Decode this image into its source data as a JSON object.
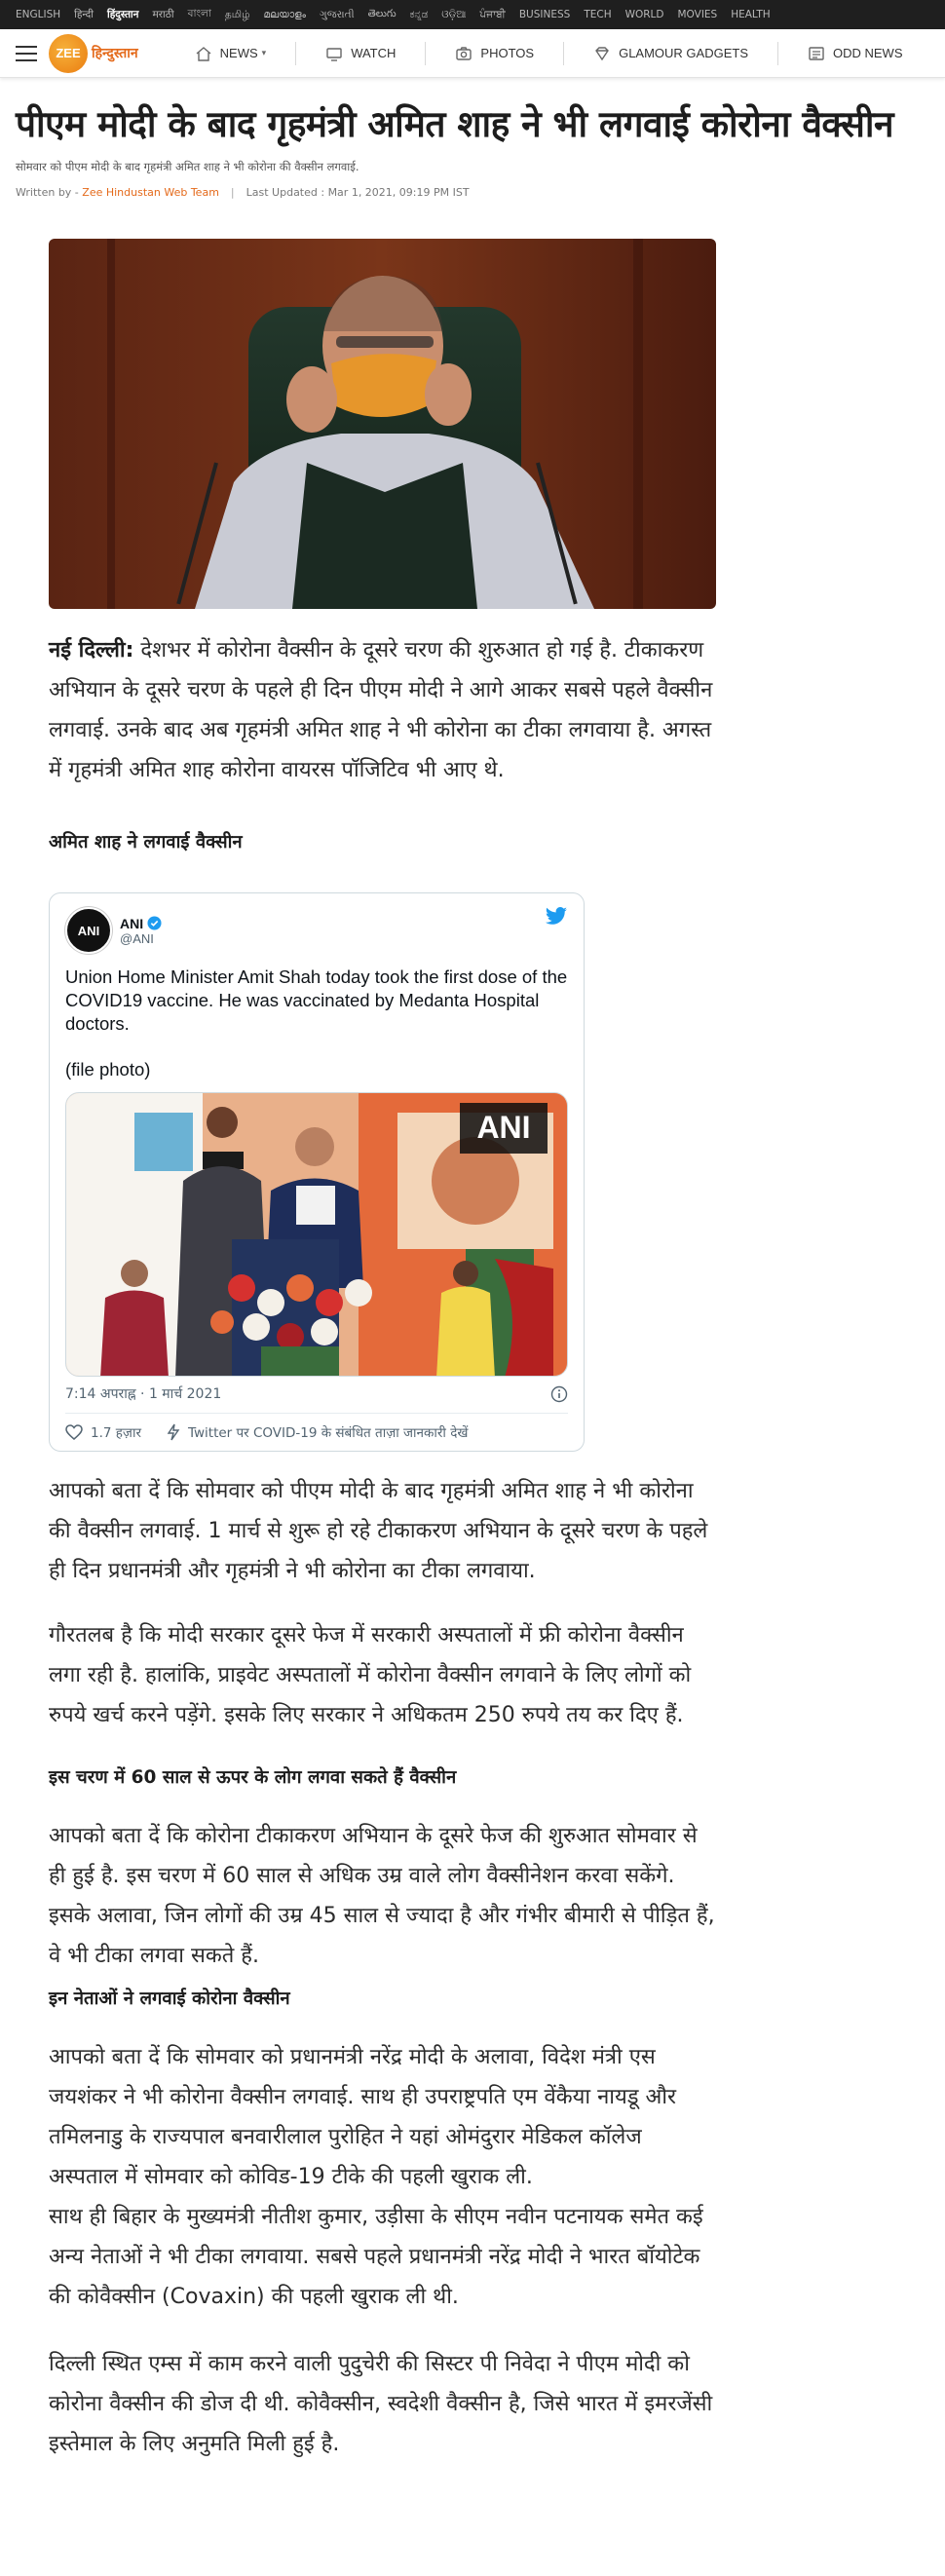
{
  "langbar": {
    "items": [
      "ENGLISH",
      "हिन्दी",
      "हिंदुस्तान",
      "मराठी",
      "বাংলা",
      "தமிழ்",
      "മലയാളം",
      "ગુજરાતી",
      "తెలుగు",
      "ಕನ್ನಡ",
      "ଓଡ଼ିଆ",
      "ਪੰਜਾਬੀ",
      "BUSINESS",
      "TECH",
      "WORLD",
      "MOVIES",
      "HEALTH"
    ],
    "active_index": 2
  },
  "nav": {
    "logo_mark": "ZEE",
    "logo_text": "हिन्दुस्तान",
    "items": [
      {
        "label": "NEWS",
        "icon": "home-icon",
        "has_dropdown": true
      },
      {
        "label": "WATCH",
        "icon": "tv-icon"
      },
      {
        "label": "PHOTOS",
        "icon": "camera-icon"
      },
      {
        "label": "GLAMOUR GADGETS",
        "icon": "diamond-icon"
      },
      {
        "label": "ODD NEWS",
        "icon": "newspaper-icon"
      }
    ]
  },
  "article": {
    "title": "पीएम मोदी के बाद गृहमंत्री अमित शाह ने भी लगवाई कोरोना वैक्सीन",
    "summary": "सोमवार को पीएम मोदी के बाद गृहमंत्री अमित शाह ने भी कोरोना की वैक्सीन लगवाई.",
    "byline_prefix": "Written by - ",
    "author": "Zee Hindustan Web Team",
    "byline_sep": "|",
    "updated": "Last Updated : Mar 1, 2021, 09:19 PM IST",
    "lead_place": "नई दिल्ली:",
    "lead_text": " देशभर में कोरोना वैक्सीन के दूसरे चरण की शुरुआत हो गई है. टीकाकरण अभियान के दूसरे चरण के पहले ही दिन पीएम मोदी ने आगे आकर सबसे पहले वैक्सीन लगवाई. उनके बाद अब गृहमंत्री अमित शाह ने भी कोरोना का टीका लगवाया है. अगस्त में गृहमंत्री अमित शाह कोरोना वायरस पॉजिटिव भी आए थे.",
    "subhead_1": "अमित शाह ने लगवाई वैक्सीन",
    "para_2": "आपको बता दें कि सोमवार को पीएम मोदी के बाद गृहमंत्री अमित शाह ने भी कोरोना की वैक्सीन लगवाई. 1 मार्च से शुरू हो रहे टीकाकरण अभियान के दूसरे चरण के पहले ही दिन प्रधानमंत्री और गृहमंत्री ने भी कोरोना का टीका लगवाया.",
    "para_3": "गौरतलब है कि मोदी सरकार दूसरे फेज में सरकारी अस्पतालों में फ्री कोरोना वैक्सीन लगा रही है. हालांकि, प्राइवेट अस्पतालों में कोरोना वैक्सीन लगवाने के लिए लोगों को रुपये खर्च करने पड़ेंगे. इसके लिए सरकार ने अधिकतम 250 रुपये तय कर दिए हैं.",
    "subhead_2": "इस चरण में 60 साल से ऊपर के लोग लगवा सकते हैं वैक्सीन",
    "para_4": "आपको बता दें कि कोरोना टीकाकरण अभियान के दूसरे फेज की शुरुआत सोमवार से ही हुई है. इस चरण में 60 साल से अधिक उम्र वाले लोग वैक्सीनेशन करवा सकेंगे. इसके अलावा, जिन लोगों की उम्र 45 साल से ज्यादा है और गंभीर बीमारी से पीड़ित हैं, वे भी टीका लगवा सकते हैं.",
    "subhead_3": "इन नेताओं ने लगवाई कोरोना वैक्सीन",
    "para_5": "आपको बता दें कि सोमवार को प्रधानमंत्री नरेंद्र मोदी के अलावा, विदेश मंत्री एस जयशंकर ने भी कोरोना वैक्सीन लगवाई. साथ ही उपराष्ट्रपति एम वेंकैया नायडू और तमिलनाडु के राज्यपाल बनवारीलाल पुरोहित ने यहां ओमंदुरार मेडिकल कॉलेज अस्पताल में सोमवार को कोविड-19 टीके की पहली खुराक ली.",
    "para_6": "साथ ही बिहार के मुख्यमंत्री नीतीश कुमार, उड़ीसा के सीएम नवीन पटनायक समेत कई अन्य नेताओं ने भी टीका लगवाया. सबसे पहले प्रधानमंत्री नरेंद्र मोदी ने भारत बॉयोटेक की कोवैक्सीन (Covaxin) की पहली खुराक ली थी.",
    "para_7": "दिल्ली स्थित एम्स में काम करने वाली पुदुचेरी की सिस्टर पी निवेदा ने पीएम मोदी को कोरोना वैक्सीन की डोज दी थी. कोवैक्सीन, स्वदेशी वैक्सीन है, जिसे भारत में इमरजेंसी इस्तेमाल के लिए अनुमति मिली हुई है."
  },
  "tweet": {
    "avatar_text": "ANI",
    "name": "ANI",
    "handle": "@ANI",
    "text": "Union Home Minister Amit Shah today took the first dose of the COVID19 vaccine. He was vaccinated by Medanta Hospital doctors.",
    "photo_note": "(file photo)",
    "media_watermark": "ANI",
    "timestamp": "7:14 अपराह्न · 1 मार्च 2021",
    "likes": "1.7 हज़ार",
    "covid_link": "Twitter पर COVID-19 के संबंधित ताज़ा जानकारी देखें"
  },
  "colors": {
    "accent": "#e46a1b",
    "twitter_blue": "#1d9bf0",
    "langbar_bg": "#1f1f1f"
  }
}
